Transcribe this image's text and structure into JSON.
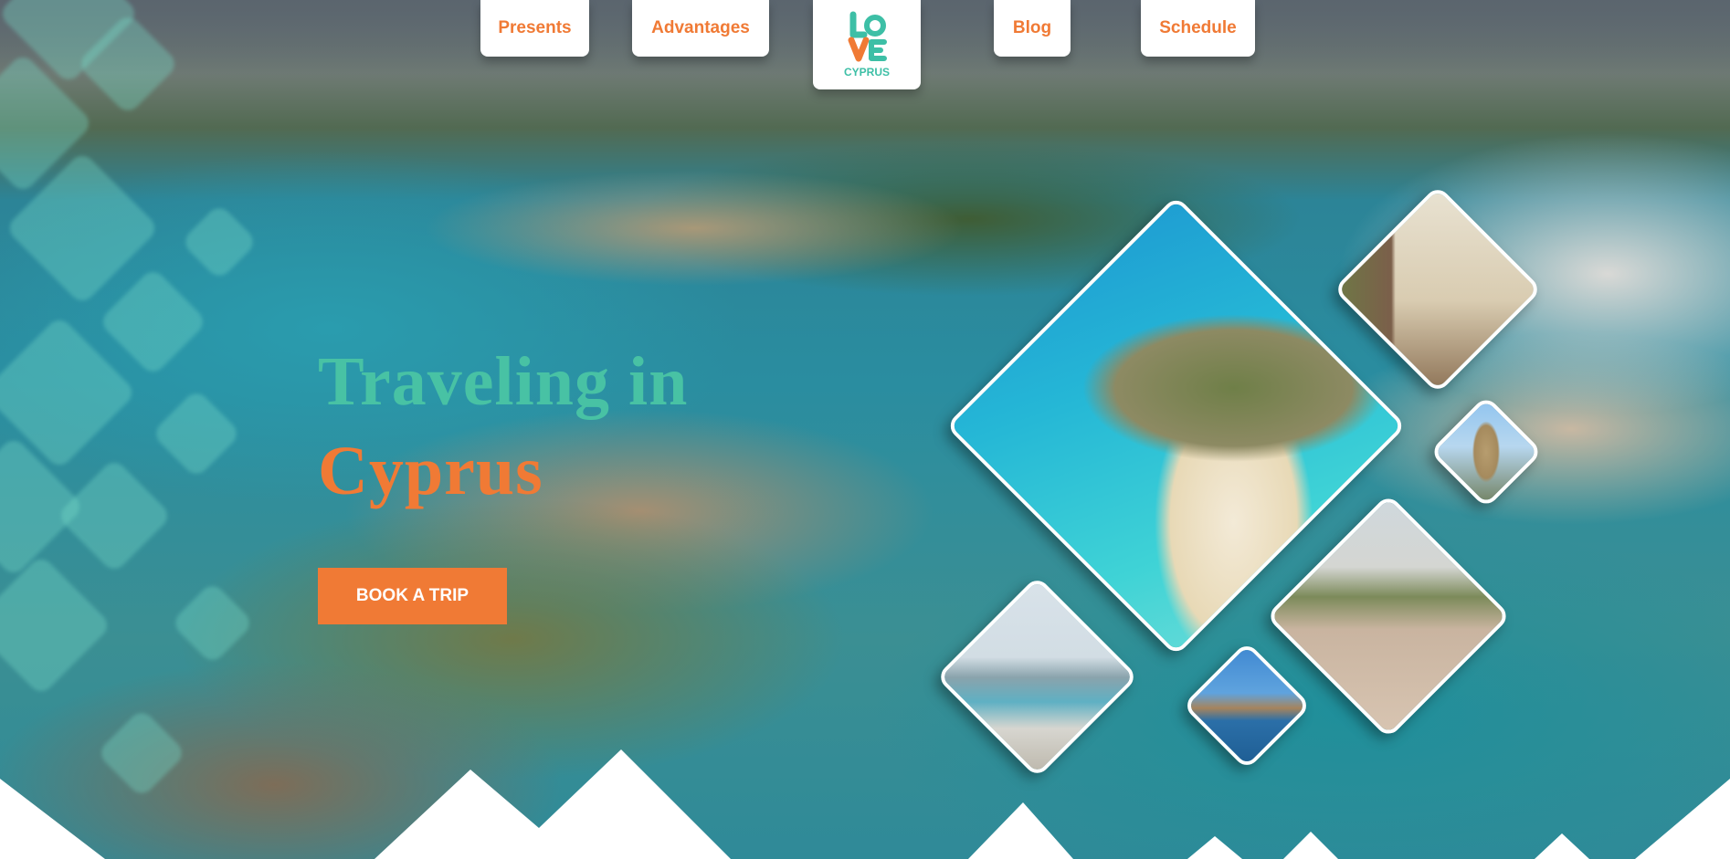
{
  "nav": {
    "items": [
      {
        "label": "Presents"
      },
      {
        "label": "Advantages"
      },
      {
        "label": "Blog"
      },
      {
        "label": "Schedule"
      }
    ],
    "logo": {
      "top": "lo",
      "bottom": "ve",
      "word": "CYPRUS"
    }
  },
  "hero": {
    "title_line1": "Traveling in",
    "title_line2": "Cyprus",
    "cta_label": "BOOK A TRIP"
  },
  "colors": {
    "accent_orange": "#f07a35",
    "accent_teal": "#48c2a4",
    "logo_teal": "#3dbfa6"
  },
  "gallery": {
    "photos": [
      {
        "subject": "beach-island-photo"
      },
      {
        "subject": "old-house-photo"
      },
      {
        "subject": "church-tower-photo"
      },
      {
        "subject": "palm-street-photo"
      },
      {
        "subject": "seaside-promenade-photo"
      },
      {
        "subject": "harbor-photo"
      }
    ]
  }
}
